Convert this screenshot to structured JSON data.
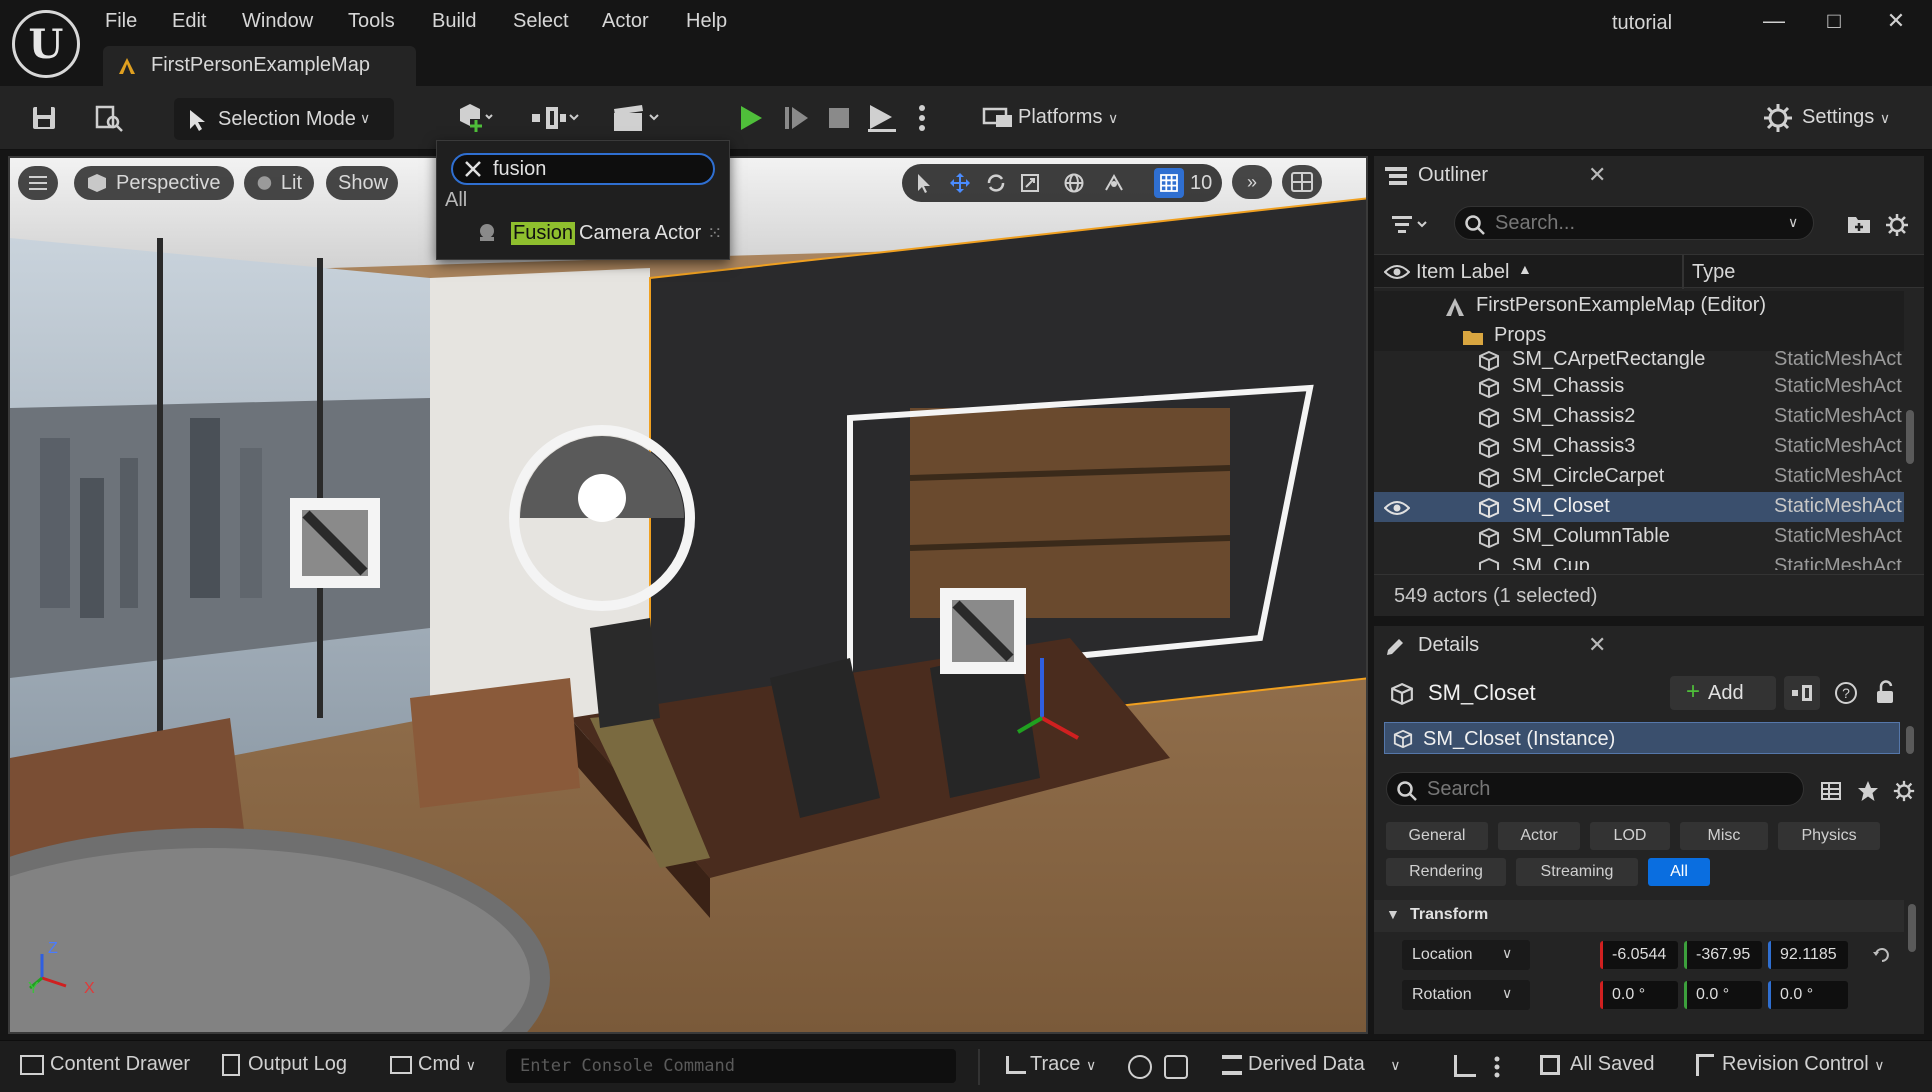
{
  "menu": [
    "File",
    "Edit",
    "Window",
    "Tools",
    "Build",
    "Select",
    "Actor",
    "Help"
  ],
  "window": {
    "title": "tutorial"
  },
  "tab": {
    "label": "FirstPersonExampleMap"
  },
  "toolbar": {
    "selection_mode": "Selection Mode",
    "platforms": "Platforms",
    "settings": "Settings"
  },
  "viewport": {
    "perspective": "Perspective",
    "lit": "Lit",
    "show": "Show",
    "grid_value": "10",
    "axis_z": "Z",
    "axis_y": "Y",
    "axis_x": "X"
  },
  "popup": {
    "query": "fusion",
    "category": "All",
    "match": "Fusion",
    "rest": "Camera Actor"
  },
  "outliner": {
    "title": "Outliner",
    "search_placeholder": "Search...",
    "col_label": "Item Label",
    "col_type": "Type",
    "root": "FirstPersonExampleMap (Editor)",
    "folder": "Props",
    "items": [
      {
        "name": "SM_CArpetRectangle",
        "type": "StaticMeshAct"
      },
      {
        "name": "SM_Chassis",
        "type": "StaticMeshAct"
      },
      {
        "name": "SM_Chassis2",
        "type": "StaticMeshAct"
      },
      {
        "name": "SM_Chassis3",
        "type": "StaticMeshAct"
      },
      {
        "name": "SM_CircleCarpet",
        "type": "StaticMeshAct"
      },
      {
        "name": "SM_Closet",
        "type": "StaticMeshAct"
      },
      {
        "name": "SM_ColumnTable",
        "type": "StaticMeshAct"
      },
      {
        "name": "SM_Cup",
        "type": "StaticMeshAct"
      }
    ],
    "status": "549 actors (1 selected)"
  },
  "details": {
    "title": "Details",
    "actor_name": "SM_Closet",
    "add_label": "Add",
    "instance": "SM_Closet (Instance)",
    "search_placeholder": "Search",
    "categories_row1": [
      "General",
      "Actor",
      "LOD",
      "Misc",
      "Physics"
    ],
    "categories_row2": [
      "Rendering",
      "Streaming",
      "All"
    ],
    "section": "Transform",
    "location_label": "Location",
    "rotation_label": "Rotation",
    "location": [
      "-6.0544",
      "-367.95",
      "92.1185"
    ],
    "rotation": [
      "0.0 °",
      "0.0 °",
      "0.0 °"
    ]
  },
  "bottombar": {
    "content_drawer": "Content Drawer",
    "output_log": "Output Log",
    "cmd": "Cmd",
    "console_placeholder": "Enter Console Command",
    "trace": "Trace",
    "derived_data": "Derived Data",
    "all_saved": "All Saved",
    "revision_control": "Revision Control"
  },
  "colors": {
    "accent": "#2f6fd1",
    "selection": "#3a4f6d",
    "play_green": "#4fbf3a",
    "highlight": "#8fbf2e"
  }
}
